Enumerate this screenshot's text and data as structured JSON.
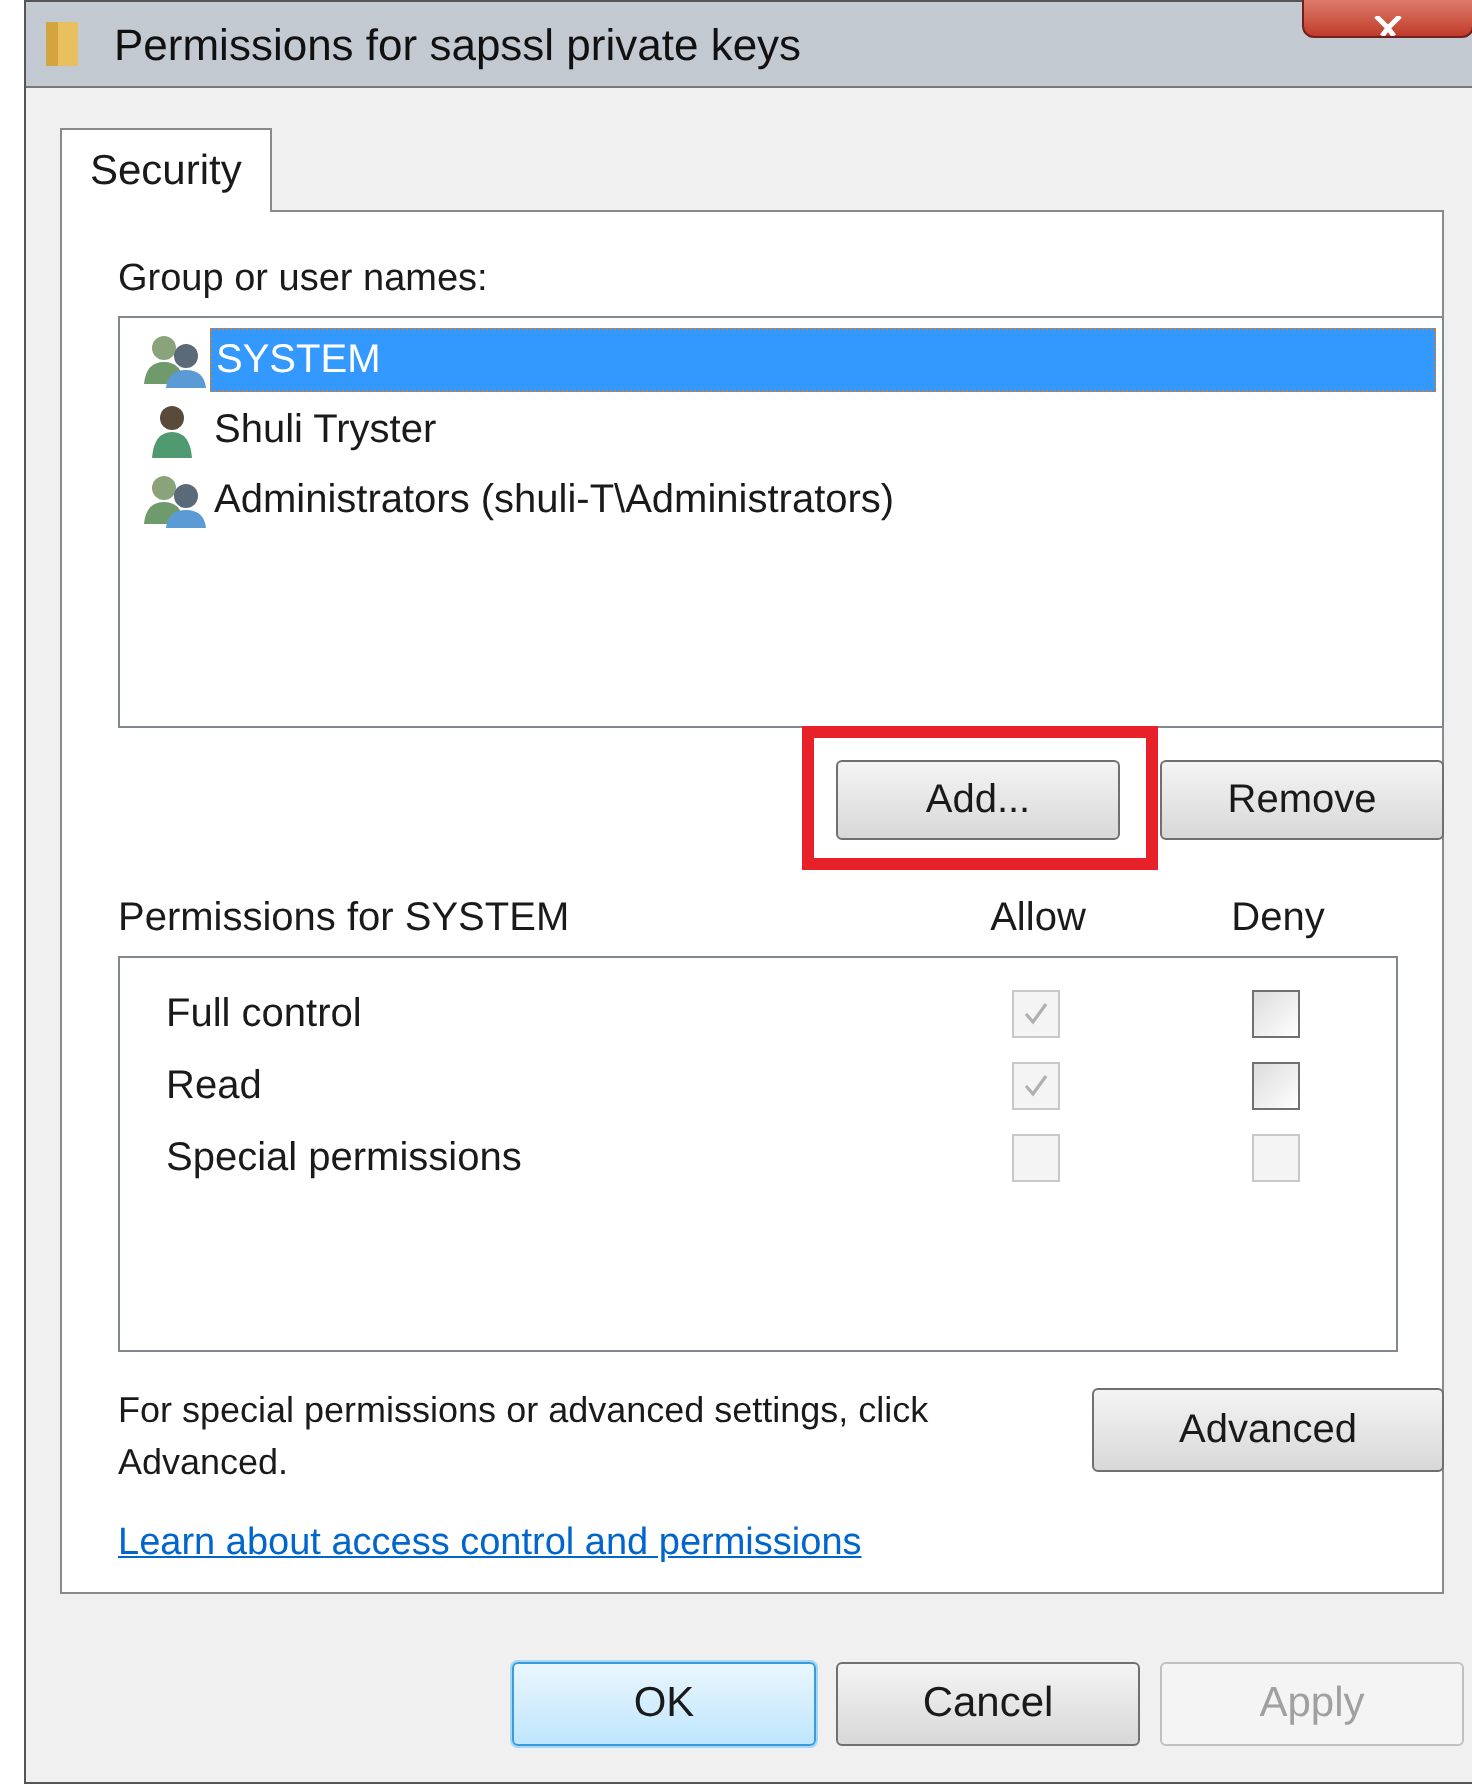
{
  "window": {
    "title": "Permissions for sapssl private keys"
  },
  "tabs": [
    {
      "label": "Security",
      "selected": true
    }
  ],
  "group_label": "Group or user names:",
  "users": [
    {
      "name": "SYSTEM",
      "kind": "group",
      "selected": true
    },
    {
      "name": "Shuli Tryster",
      "kind": "user",
      "selected": false
    },
    {
      "name": "Administrators (shuli-T\\Administrators)",
      "kind": "group",
      "selected": false
    }
  ],
  "user_buttons": [
    {
      "label": "Add...",
      "highlighted": true
    },
    {
      "label": "Remove",
      "highlighted": false
    }
  ],
  "permissions": {
    "title": "Permissions for SYSTEM",
    "allow_heading": "Allow",
    "deny_heading": "Deny",
    "rows": [
      {
        "name": "Full control",
        "allow": {
          "checked": true,
          "disabled": true
        },
        "deny": {
          "checked": false,
          "disabled": false
        }
      },
      {
        "name": "Read",
        "allow": {
          "checked": true,
          "disabled": true
        },
        "deny": {
          "checked": false,
          "disabled": false
        }
      },
      {
        "name": "Special permissions",
        "allow": {
          "checked": false,
          "disabled": true
        },
        "deny": {
          "checked": false,
          "disabled": true
        }
      }
    ]
  },
  "advanced_note": "For special permissions or advanced settings, click Advanced.",
  "advanced_button": "Advanced",
  "help_link": "Learn about access control and permissions",
  "buttons": [
    {
      "label": "OK",
      "default": true,
      "disabled": false
    },
    {
      "label": "Cancel",
      "default": false,
      "disabled": false
    },
    {
      "label": "Apply",
      "default": false,
      "disabled": true
    }
  ]
}
